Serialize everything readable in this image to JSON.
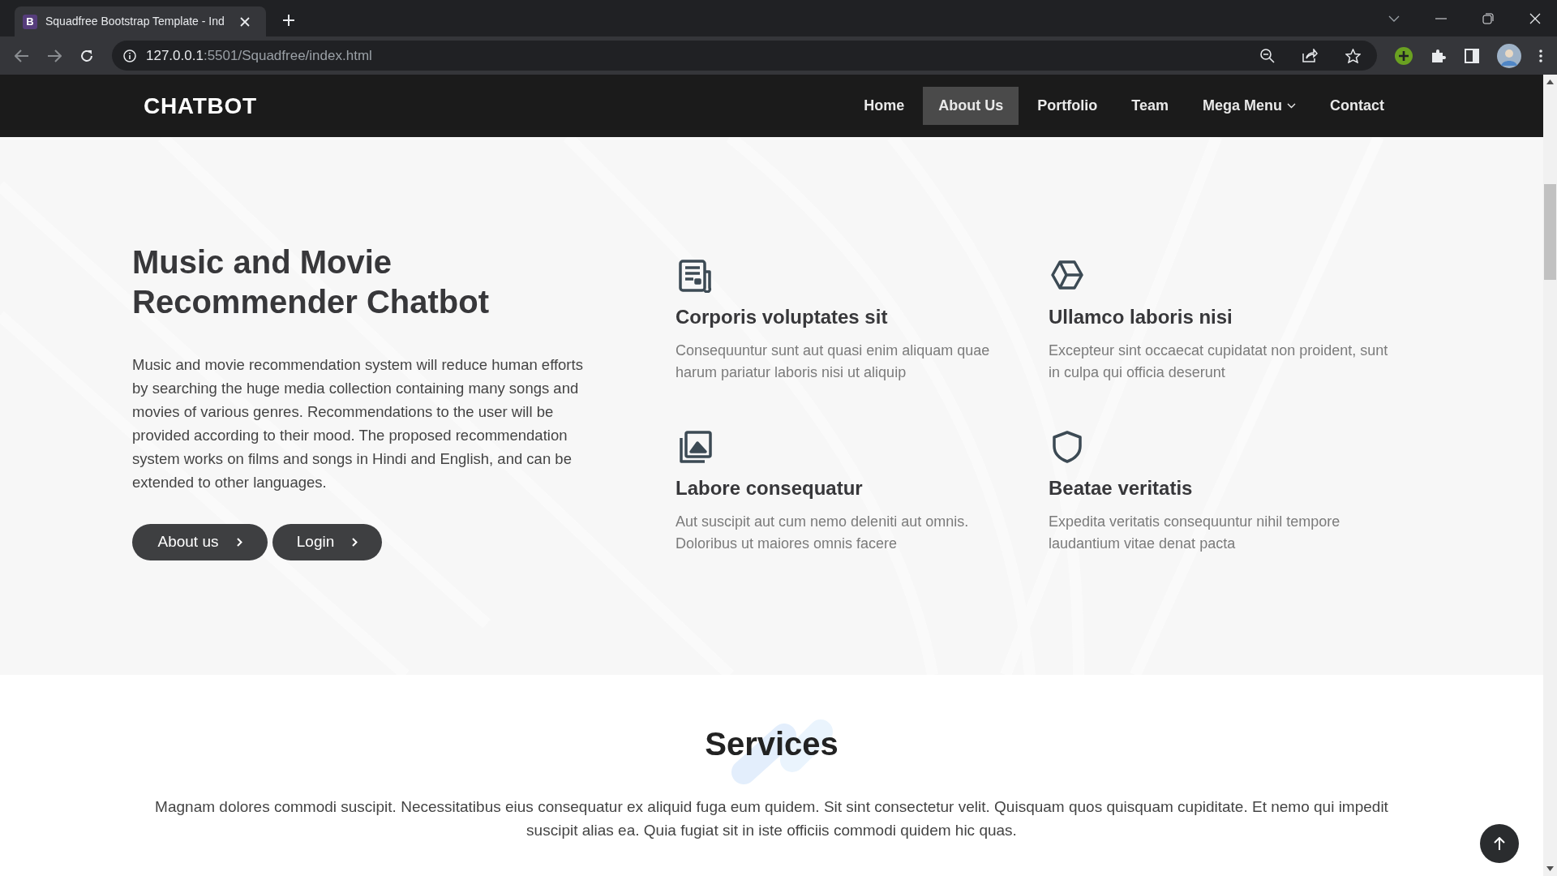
{
  "browser": {
    "tab_title": "Squadfree Bootstrap Template - Ind",
    "tab_favicon": "B",
    "url_host": "127.0.0.1",
    "url_path": ":5501/Squadfree/index.html"
  },
  "navbar": {
    "logo": "CHATBOT",
    "items": [
      {
        "label": "Home",
        "selected": false,
        "dropdown": false
      },
      {
        "label": "About Us",
        "selected": true,
        "dropdown": false
      },
      {
        "label": "Portfolio",
        "selected": false,
        "dropdown": false
      },
      {
        "label": "Team",
        "selected": false,
        "dropdown": false
      },
      {
        "label": "Mega Menu",
        "selected": false,
        "dropdown": true
      },
      {
        "label": "Contact",
        "selected": false,
        "dropdown": false
      }
    ]
  },
  "hero": {
    "title": "Music and Movie Recommender Chatbot",
    "text": "Music and movie recommendation system will reduce human efforts by searching the huge media collection containing many songs and movies of various genres. Recommendations to the user will be provided according to their mood. The proposed recommendation system works on films and songs in Hindi and English, and can be extended to other languages.",
    "buttons": [
      "About us",
      "Login"
    ]
  },
  "features": [
    {
      "kind": "document",
      "title": "Corporis voluptates sit",
      "text": "Consequuntur sunt aut quasi enim aliquam quae harum pariatur laboris nisi ut aliquip"
    },
    {
      "kind": "cube",
      "title": "Ullamco laboris nisi",
      "text": "Excepteur sint occaecat cupidatat non proident, sunt in culpa qui officia deserunt"
    },
    {
      "kind": "images",
      "title": "Labore consequatur",
      "text": "Aut suscipit aut cum nemo deleniti aut omnis. Doloribus ut maiores omnis facere"
    },
    {
      "kind": "shield",
      "title": "Beatae veritatis",
      "text": "Expedita veritatis consequuntur nihil tempore laudantium vitae denat pacta"
    }
  ],
  "services": {
    "title": "Services",
    "text": "Magnam dolores commodi suscipit. Necessitatibus eius consequatur ex aliquid fuga eum quidem. Sit sint consectetur velit. Quisquam quos quisquam cupiditate. Et nemo qui impedit suscipit alias ea. Quia fugiat sit in iste officiis commodi quidem hic quas."
  }
}
